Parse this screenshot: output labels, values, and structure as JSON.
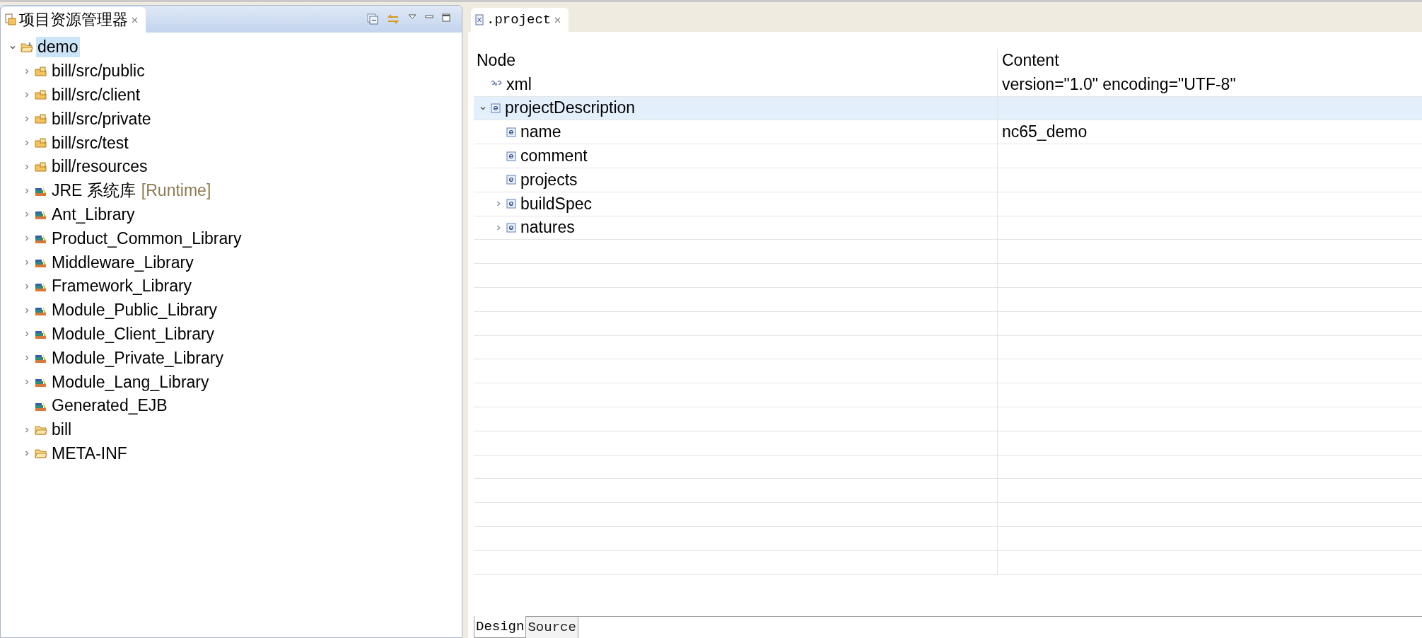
{
  "explorer": {
    "title": "项目资源管理器",
    "tree": [
      {
        "label": "demo",
        "kind": "project",
        "selected": true,
        "expanded": true,
        "children": [
          {
            "label": "bill/src/public",
            "kind": "package-folder",
            "selected": false,
            "expanded": false
          },
          {
            "label": "bill/src/client",
            "kind": "package-folder",
            "selected": false,
            "expanded": false
          },
          {
            "label": "bill/src/private",
            "kind": "package-folder",
            "selected": false,
            "expanded": false
          },
          {
            "label": "bill/src/test",
            "kind": "package-folder",
            "selected": false,
            "expanded": false
          },
          {
            "label": "bill/resources",
            "kind": "package-folder",
            "selected": false,
            "expanded": false
          },
          {
            "label": "JRE 系统库",
            "decoration": "[Runtime]",
            "kind": "library",
            "selected": false,
            "expanded": false
          },
          {
            "label": "Ant_Library",
            "kind": "library",
            "selected": false,
            "expanded": false
          },
          {
            "label": "Product_Common_Library",
            "kind": "library",
            "selected": false,
            "expanded": false
          },
          {
            "label": "Middleware_Library",
            "kind": "library",
            "selected": false,
            "expanded": false
          },
          {
            "label": "Framework_Library",
            "kind": "library",
            "selected": false,
            "expanded": false
          },
          {
            "label": "Module_Public_Library",
            "kind": "library",
            "selected": false,
            "expanded": false
          },
          {
            "label": "Module_Client_Library",
            "kind": "library",
            "selected": false,
            "expanded": false
          },
          {
            "label": "Module_Private_Library",
            "kind": "library",
            "selected": false,
            "expanded": false
          },
          {
            "label": "Module_Lang_Library",
            "kind": "library",
            "selected": false,
            "expanded": false
          },
          {
            "label": "Generated_EJB",
            "kind": "library",
            "selected": false
          },
          {
            "label": "bill",
            "kind": "folder",
            "selected": false,
            "expanded": false
          },
          {
            "label": "META-INF",
            "kind": "folder",
            "selected": false,
            "expanded": false
          }
        ]
      }
    ]
  },
  "editor": {
    "tab": ".project",
    "columns": [
      "Node",
      "Content"
    ],
    "rows": [
      {
        "node": "xml",
        "content": "version=\"1.0\" encoding=\"UTF-8\"",
        "kind": "instruction",
        "selected": false
      },
      {
        "node": "projectDescription",
        "kind": "element",
        "selected": true,
        "expanded": true,
        "children": [
          {
            "node": "name",
            "content": "nc65_demo",
            "kind": "element",
            "selected": false
          },
          {
            "node": "comment",
            "kind": "element",
            "selected": false
          },
          {
            "node": "projects",
            "kind": "element",
            "selected": false
          },
          {
            "node": "buildSpec",
            "kind": "element",
            "selected": false,
            "expanded": false
          },
          {
            "node": "natures",
            "kind": "element",
            "selected": false,
            "expanded": false
          }
        ]
      }
    ],
    "bottom_tabs": [
      {
        "label": "Design",
        "selected": true
      },
      {
        "label": "Source",
        "selected": false
      }
    ]
  }
}
